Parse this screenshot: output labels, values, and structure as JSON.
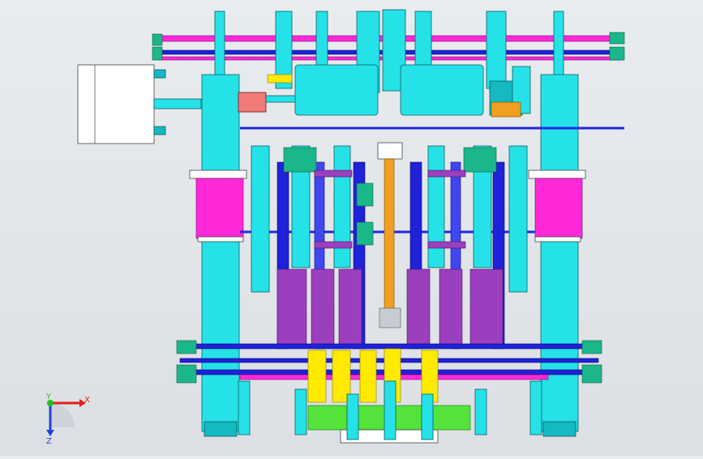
{
  "viewport": {
    "background": "#e4e7ea",
    "colors": {
      "cyan": "#25e2e8",
      "blue": "#1f22d8",
      "pink": "#ff29d9",
      "purple": "#9b3fbf",
      "yellow": "#ffea00",
      "green": "#53e33b"
    }
  },
  "triad": {
    "x_label": "X",
    "y_label": "Y",
    "z_label": "Z",
    "x_color": "#e02020",
    "y_color": "#20c020",
    "z_color": "#2040e0"
  }
}
